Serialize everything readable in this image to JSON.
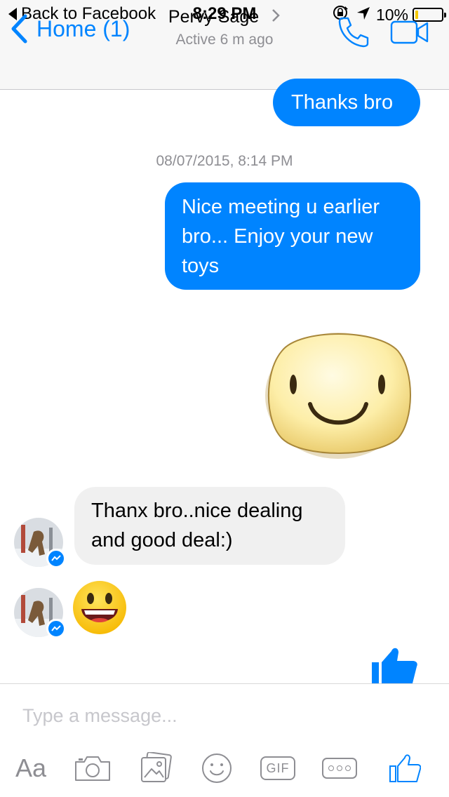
{
  "status_bar": {
    "back_label": "Back to Facebook",
    "time": "8:29 PM",
    "battery": "10%"
  },
  "nav": {
    "back_label": "Home (1)",
    "contact_name": "Pervy Sage",
    "contact_status": "Active 6 m ago"
  },
  "messages": {
    "m1": "Thanks bro",
    "timestamp": "08/07/2015, 8:14 PM",
    "m2_line1": "Nice meeting u earlier",
    "m2_line2": "bro... Enjoy your new",
    "m2_line3": "toys",
    "m3_line1": "Thanx bro..nice dealing",
    "m3_line2": "and good deal:)"
  },
  "composer": {
    "placeholder": "Type a message...",
    "text_tool": "Aa",
    "gif_label": "GIF"
  },
  "colors": {
    "accent": "#0084ff",
    "incoming_bubble": "#f0f0f0",
    "battery_low": "#f6c900"
  },
  "icons": [
    "lock-rotation-icon",
    "location-arrow-icon",
    "battery-icon",
    "phone-icon",
    "video-icon",
    "camera-icon",
    "photo-icon",
    "emoji-icon",
    "gif-icon",
    "more-icon",
    "like-icon"
  ]
}
